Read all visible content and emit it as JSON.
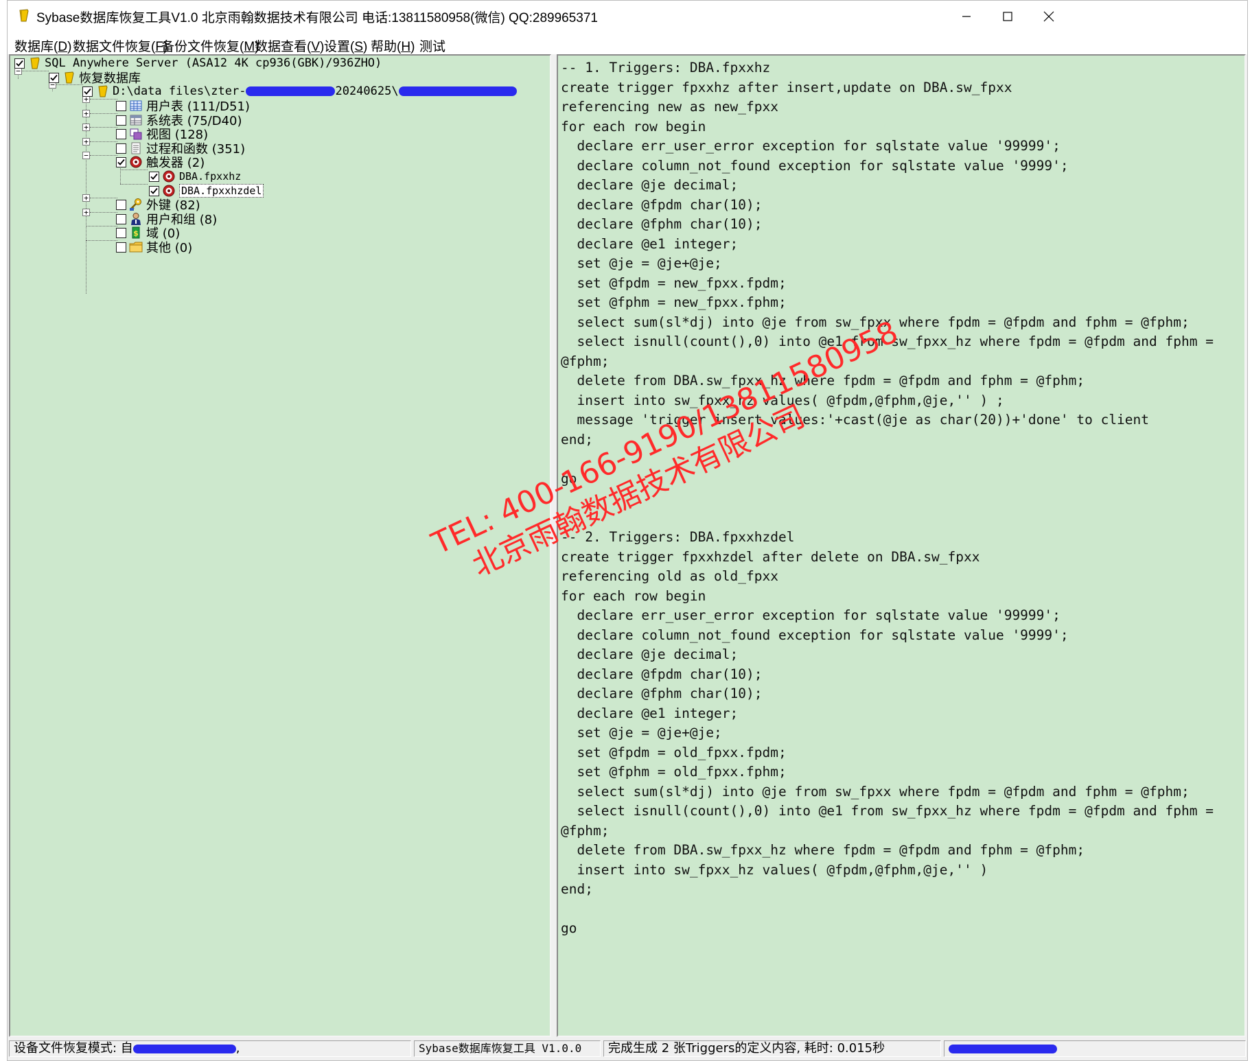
{
  "window": {
    "title": "Sybase数据库恢复工具V1.0    北京雨翰数据技术有限公司    电话:13811580958(微信)    QQ:289965371"
  },
  "menu": [
    {
      "label": "数据库(",
      "acc": "D",
      "tail": ")"
    },
    {
      "label": "数据文件恢复(",
      "acc": "F",
      "tail": ")"
    },
    {
      "label": "备份文件恢复(",
      "acc": "M",
      "tail": ")"
    },
    {
      "label": "数据查看(",
      "acc": "V",
      "tail": ")"
    },
    {
      "label": "设置(",
      "acc": "S",
      "tail": ")"
    },
    {
      "label": "帮助(",
      "acc": "H",
      "tail": ")"
    },
    {
      "label": "测试",
      "acc": "",
      "tail": ""
    }
  ],
  "tree": {
    "server": "SQL Anywhere Server (ASA12 4K cp936(GBK)/936ZHO)",
    "recovered_db": "恢复数据库",
    "file_path_prefix": "D:\\data files\\zter-",
    "file_path_mid": "20240625\\",
    "categories": {
      "user_tables": "用户表 (111/D51)",
      "system_tables": "系统表 (75/D40)",
      "views": "视图 (128)",
      "procedures": "过程和函数 (351)",
      "triggers": "触发器 (2)",
      "trigger_1": "DBA.fpxxhz",
      "trigger_2": "DBA.fpxxhzdel",
      "foreign_keys": "外键 (82)",
      "users_groups": "用户和组 (8)",
      "domains": "域 (0)",
      "others": "其他 (0)"
    }
  },
  "code_text": "-- 1. Triggers: DBA.fpxxhz\ncreate trigger fpxxhz after insert,update on DBA.sw_fpxx\nreferencing new as new_fpxx\nfor each row begin\n  declare err_user_error exception for sqlstate value '99999';\n  declare column_not_found exception for sqlstate value '9999';\n  declare @je decimal;\n  declare @fpdm char(10);\n  declare @fphm char(10);\n  declare @e1 integer;\n  set @je = @je+@je;\n  set @fpdm = new_fpxx.fpdm;\n  set @fphm = new_fpxx.fphm;\n  select sum(sl*dj) into @je from sw_fpxx where fpdm = @fpdm and fphm = @fphm;\n  select isnull(count(),0) into @e1 from sw_fpxx_hz where fpdm = @fpdm and fphm =\n@fphm;\n  delete from DBA.sw_fpxx_hz where fpdm = @fpdm and fphm = @fphm;\n  insert into sw_fpxx_hz values( @fpdm,@fphm,@je,'' ) ;\n  message 'trigger insert values:'+cast(@je as char(20))+'done' to client\nend;\n\ngo\n\n\n-- 2. Triggers: DBA.fpxxhzdel\ncreate trigger fpxxhzdel after delete on DBA.sw_fpxx\nreferencing old as old_fpxx\nfor each row begin\n  declare err_user_error exception for sqlstate value '99999';\n  declare column_not_found exception for sqlstate value '9999';\n  declare @je decimal;\n  declare @fpdm char(10);\n  declare @fphm char(10);\n  declare @e1 integer;\n  set @je = @je+@je;\n  set @fpdm = old_fpxx.fpdm;\n  set @fphm = old_fpxx.fphm;\n  select sum(sl*dj) into @je from sw_fpxx where fpdm = @fpdm and fphm = @fphm;\n  select isnull(count(),0) into @e1 from sw_fpxx_hz where fpdm = @fpdm and fphm =\n@fphm;\n  delete from DBA.sw_fpxx_hz where fpdm = @fpdm and fphm = @fphm;\n  insert into sw_fpxx_hz values( @fpdm,@fphm,@je,'' )\nend;\n\ngo",
  "status": {
    "mode_prefix": "设备文件恢复模式: 自",
    "mode_suffix": ",",
    "product": "Sybase数据库恢复工具 V1.0.0",
    "message": "完成生成 2 张Triggers的定义内容, 耗时: 0.015秒"
  },
  "watermark": {
    "line1": "TEL: 400-166-9190/13811580958",
    "line2": "北京雨翰数据技术有限公司"
  },
  "colors": {
    "pane_bg": "#cde8cd",
    "watermark": "#ff2a2a",
    "redaction": "#2a2aee"
  }
}
